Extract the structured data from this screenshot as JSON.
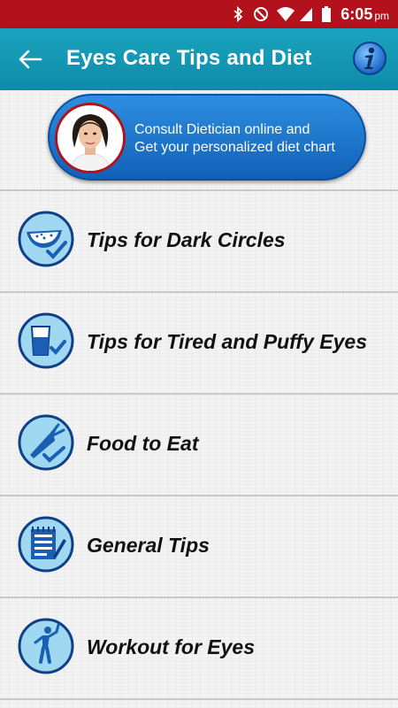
{
  "status": {
    "time": "6:05",
    "ampm": "pm"
  },
  "appbar": {
    "title": "Eyes Care Tips and Diet"
  },
  "consult": {
    "line1": "Consult Dietician online and",
    "line2": "Get your personalized diet chart"
  },
  "items": [
    {
      "label": "Tips for Dark Circles",
      "icon": "watermelon-icon"
    },
    {
      "label": "Tips for Tired and Puffy Eyes",
      "icon": "glass-icon"
    },
    {
      "label": "Food to Eat",
      "icon": "carrot-icon"
    },
    {
      "label": "General Tips",
      "icon": "notepad-icon"
    },
    {
      "label": "Workout for Eyes",
      "icon": "exercise-icon"
    }
  ],
  "colors": {
    "statusbar": "#b3121c",
    "appbar": "#1ba3bf",
    "consult": "#1e78cf",
    "iconBlue": "#1a5fb4"
  }
}
